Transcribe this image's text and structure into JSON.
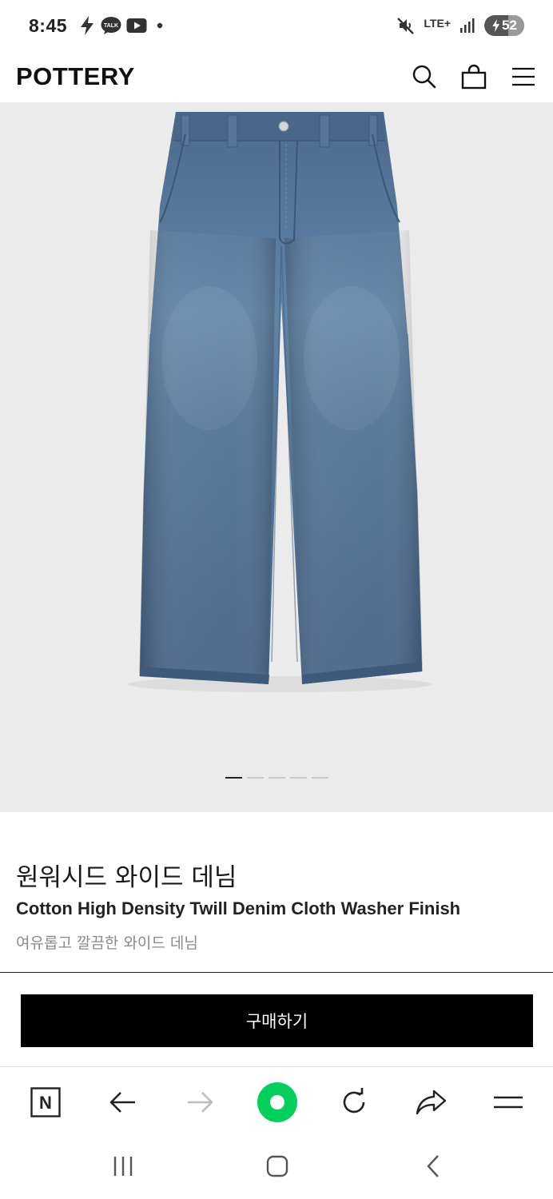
{
  "status_bar": {
    "time": "8:45",
    "left_icons": [
      "charging-bolt-icon",
      "kakao-talk-icon",
      "youtube-icon",
      "dot-icon"
    ],
    "talk_label": "TALK",
    "network": "LTE+",
    "battery_level": "52"
  },
  "header": {
    "brand": "POTTERY",
    "icons": [
      "search-icon",
      "shopping-bag-icon",
      "menu-icon"
    ]
  },
  "gallery": {
    "slide_count": 5,
    "active_slide": 1
  },
  "product": {
    "name_ko": "원워시드 와이드 데님",
    "name_en": "Cotton High Density Twill Denim Cloth Washer Finish",
    "description": "여유롭고 깔끔한 와이드 데님",
    "buy_label": "구매하기"
  },
  "browser_toolbar": {
    "icons": [
      "naver-n-icon",
      "back-arrow-icon",
      "forward-arrow-icon",
      "green-dot-icon",
      "reload-icon",
      "share-icon",
      "menu-icon"
    ],
    "naver_letter": "N",
    "accent_color": "#03cf5d"
  },
  "system_nav": {
    "icons": [
      "recent-apps-icon",
      "home-icon",
      "back-icon"
    ]
  }
}
